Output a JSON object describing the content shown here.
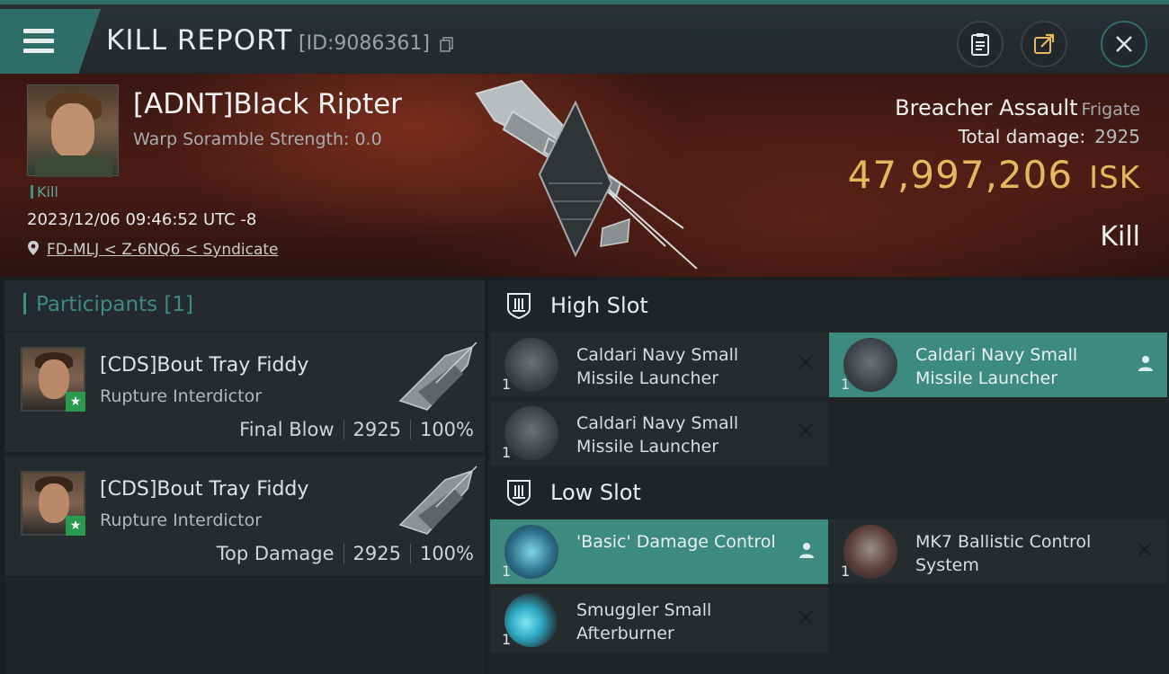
{
  "header": {
    "title": "KILL REPORT",
    "report_id": "[ID:9086361]"
  },
  "victim": {
    "name": "[ADNT]Black Ripter",
    "warp_scramble": "Warp Soramble Strength: 0.0",
    "tag": "Kill",
    "datetime": "2023/12/06 09:46:52 UTC -8",
    "location": "FD-MLJ < Z-6NQ6 < Syndicate"
  },
  "ship": {
    "name": "Breacher Assault",
    "class": "Frigate",
    "total_damage_label": "Total damage:",
    "total_damage_value": "2925",
    "isk_value": "47,997,206",
    "isk_unit": "ISK",
    "result": "Kill"
  },
  "participants": {
    "title": "Participants",
    "count": "[1]",
    "items": [
      {
        "name": "[CDS]Bout Tray Fiddy",
        "ship": "Rupture Interdictor",
        "role": "Final Blow",
        "damage": "2925",
        "percent": "100%"
      },
      {
        "name": "[CDS]Bout Tray Fiddy",
        "ship": "Rupture Interdictor",
        "role": "Top Damage",
        "damage": "2925",
        "percent": "100%"
      }
    ]
  },
  "fitting": {
    "high_slot_label": "High Slot",
    "low_slot_label": "Low Slot",
    "high": [
      {
        "qty": "1",
        "name": "Caldari Navy Small Missile Launcher",
        "state": "destroyed"
      },
      {
        "qty": "1",
        "name": "Caldari Navy Small Missile Launcher",
        "state": "dropped"
      },
      {
        "qty": "1",
        "name": "Caldari Navy Small Missile Launcher",
        "state": "destroyed"
      }
    ],
    "low": [
      {
        "qty": "1",
        "name": "'Basic' Damage Control",
        "state": "dropped"
      },
      {
        "qty": "1",
        "name": "MK7 Ballistic Control System",
        "state": "destroyed"
      },
      {
        "qty": "1",
        "name": "Smuggler Small Afterburner",
        "state": "destroyed"
      }
    ]
  },
  "colors": {
    "accent_teal": "#3c8a80",
    "isk_gold": "#e7b760",
    "bg_dark": "#1f2427"
  },
  "icons": [
    "menu-icon",
    "copy-icon",
    "clipboard-icon",
    "share-icon",
    "close-icon",
    "location-pin-icon",
    "slot-icon",
    "pilot-icon",
    "x-icon"
  ]
}
